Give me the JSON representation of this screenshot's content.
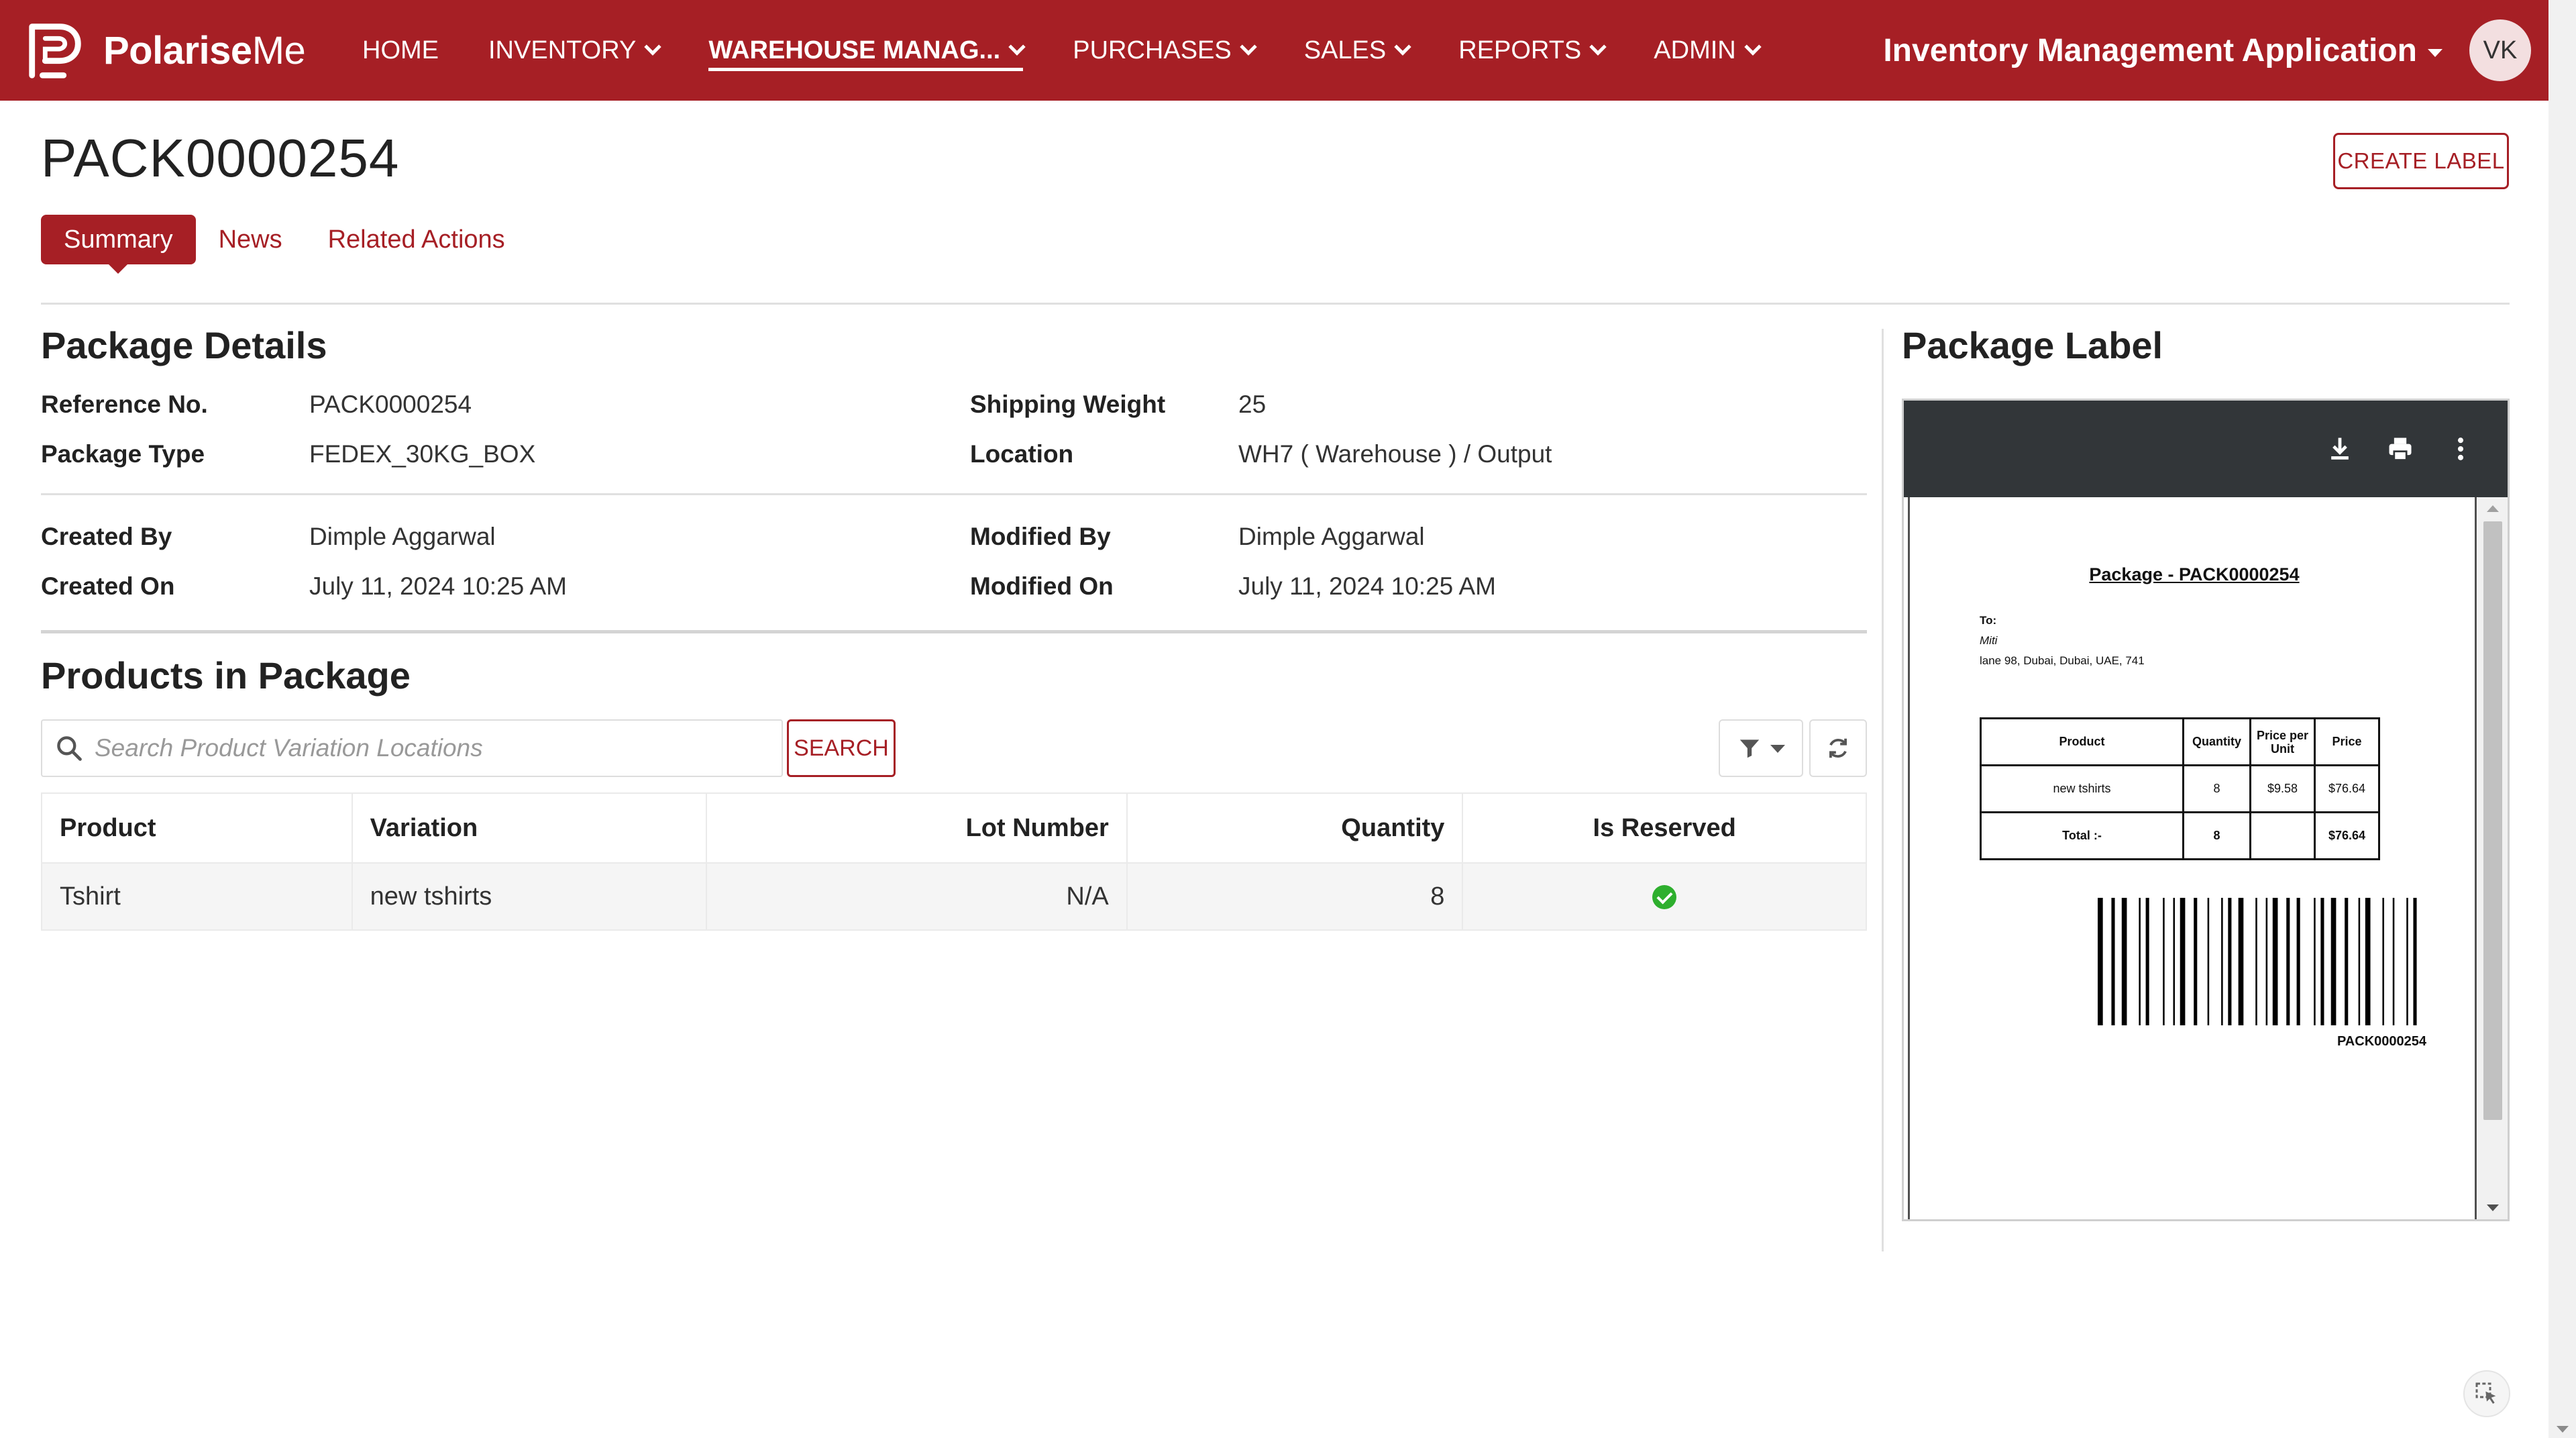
{
  "brand": {
    "name_bold": "Polarise",
    "name_light": "Me"
  },
  "nav": {
    "items": [
      {
        "label": "HOME",
        "has_menu": false,
        "active": false
      },
      {
        "label": "INVENTORY",
        "has_menu": true,
        "active": false
      },
      {
        "label": "WAREHOUSE MANAG...",
        "has_menu": true,
        "active": true
      },
      {
        "label": "PURCHASES",
        "has_menu": true,
        "active": false
      },
      {
        "label": "SALES",
        "has_menu": true,
        "active": false
      },
      {
        "label": "REPORTS",
        "has_menu": true,
        "active": false
      },
      {
        "label": "ADMIN",
        "has_menu": true,
        "active": false
      }
    ],
    "app_title": "Inventory Management Application",
    "avatar_initials": "VK"
  },
  "page": {
    "title": "PACK0000254",
    "create_label_button": "CREATE LABEL",
    "tabs": [
      "Summary",
      "News",
      "Related Actions"
    ]
  },
  "details": {
    "heading": "Package Details",
    "reference_label": "Reference No.",
    "reference_value": "PACK0000254",
    "package_type_label": "Package Type",
    "package_type_value": "FEDEX_30KG_BOX",
    "shipping_weight_label": "Shipping Weight",
    "shipping_weight_value": "25",
    "location_label": "Location",
    "location_value": "WH7 ( Warehouse ) / Output",
    "created_by_label": "Created By",
    "created_by_value": "Dimple Aggarwal",
    "created_on_label": "Created On",
    "created_on_value": "July 11, 2024 10:25 AM",
    "modified_by_label": "Modified By",
    "modified_by_value": "Dimple Aggarwal",
    "modified_on_label": "Modified On",
    "modified_on_value": "July 11, 2024 10:25 AM"
  },
  "products": {
    "heading": "Products in Package",
    "search_placeholder": "Search Product Variation Locations",
    "search_button": "SEARCH",
    "columns": [
      "Product",
      "Variation",
      "Lot Number",
      "Quantity",
      "Is Reserved"
    ],
    "rows": [
      {
        "product": "Tshirt",
        "variation": "new tshirts",
        "lot_number": "N/A",
        "quantity": "8",
        "is_reserved": true
      }
    ]
  },
  "label": {
    "heading": "Package Label",
    "doc": {
      "title": "Package - PACK0000254",
      "to_label": "To:",
      "recipient": "Miti",
      "address": "lane 98, Dubai, Dubai, UAE, 741",
      "table_headers": [
        "Product",
        "Quantity",
        "Price per Unit",
        "Price"
      ],
      "table_row": [
        "new tshirts",
        "8",
        "$9.58",
        "$76.64"
      ],
      "total_row": [
        "Total :-",
        "8",
        "",
        "$76.64"
      ],
      "barcode_text": "PACK0000254"
    }
  },
  "colors": {
    "brand": "#a61f25",
    "success": "#2eaf2e",
    "viewer_bar": "#323639"
  }
}
